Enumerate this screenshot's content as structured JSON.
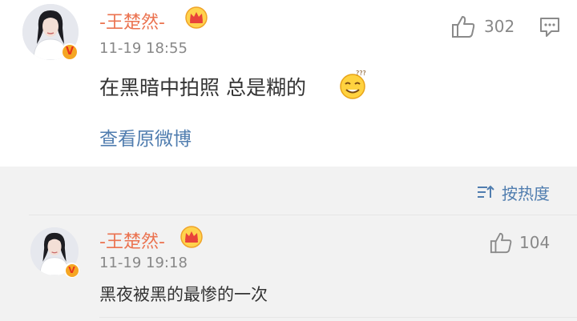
{
  "post": {
    "username": "-王楚然-",
    "timestamp": "11-19 18:55",
    "text": "在黑暗中拍照 总是糊的",
    "emoji_icon": "dizzy-smile-emoji-icon",
    "like_count": "302",
    "view_original_label": "查看原微博"
  },
  "comments": {
    "sort_label": "按热度",
    "items": [
      {
        "username": "-王楚然-",
        "timestamp": "11-19 19:18",
        "text": "黑夜被黑的最惨的一次",
        "like_count": "104"
      }
    ]
  },
  "colors": {
    "username": "#eb7350",
    "link": "#507daf",
    "meta": "#888888",
    "comments_bg": "#f2f2f2",
    "verified_badge": "#f5a623"
  },
  "verified_badge_label": "V"
}
